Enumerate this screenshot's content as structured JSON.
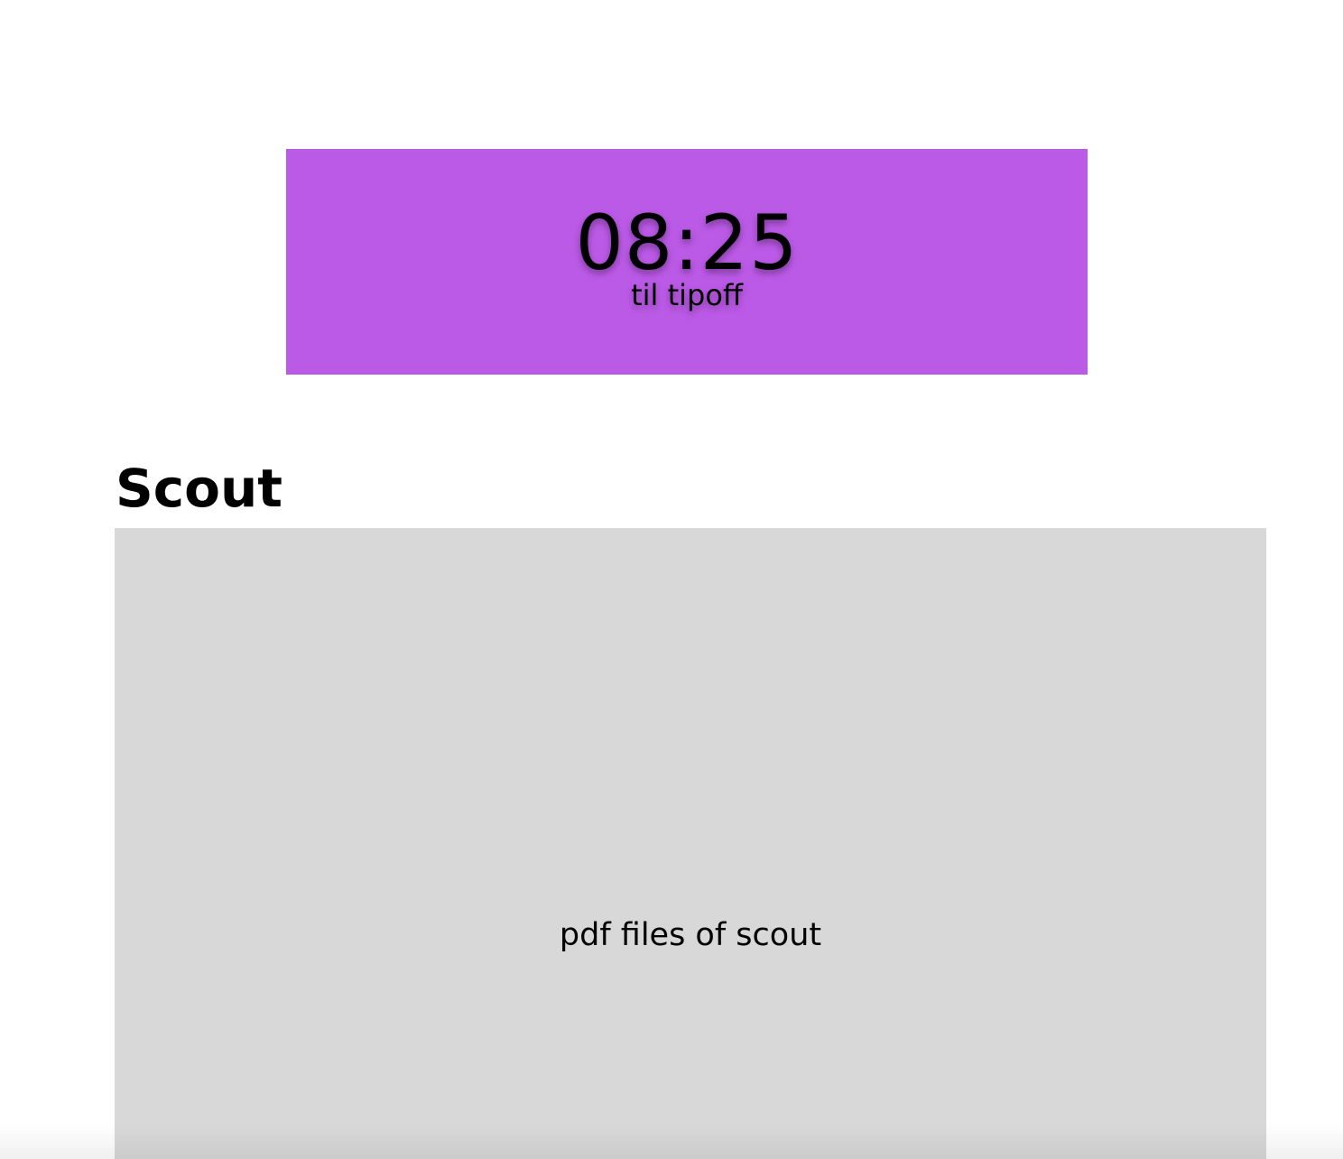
{
  "countdown": {
    "time": "08:25",
    "caption": "til tipoff",
    "background_color": "#bc5ae8"
  },
  "scout": {
    "title": "Scout",
    "placeholder": "pdf files of scout",
    "area_color": "#d8d8d8"
  }
}
